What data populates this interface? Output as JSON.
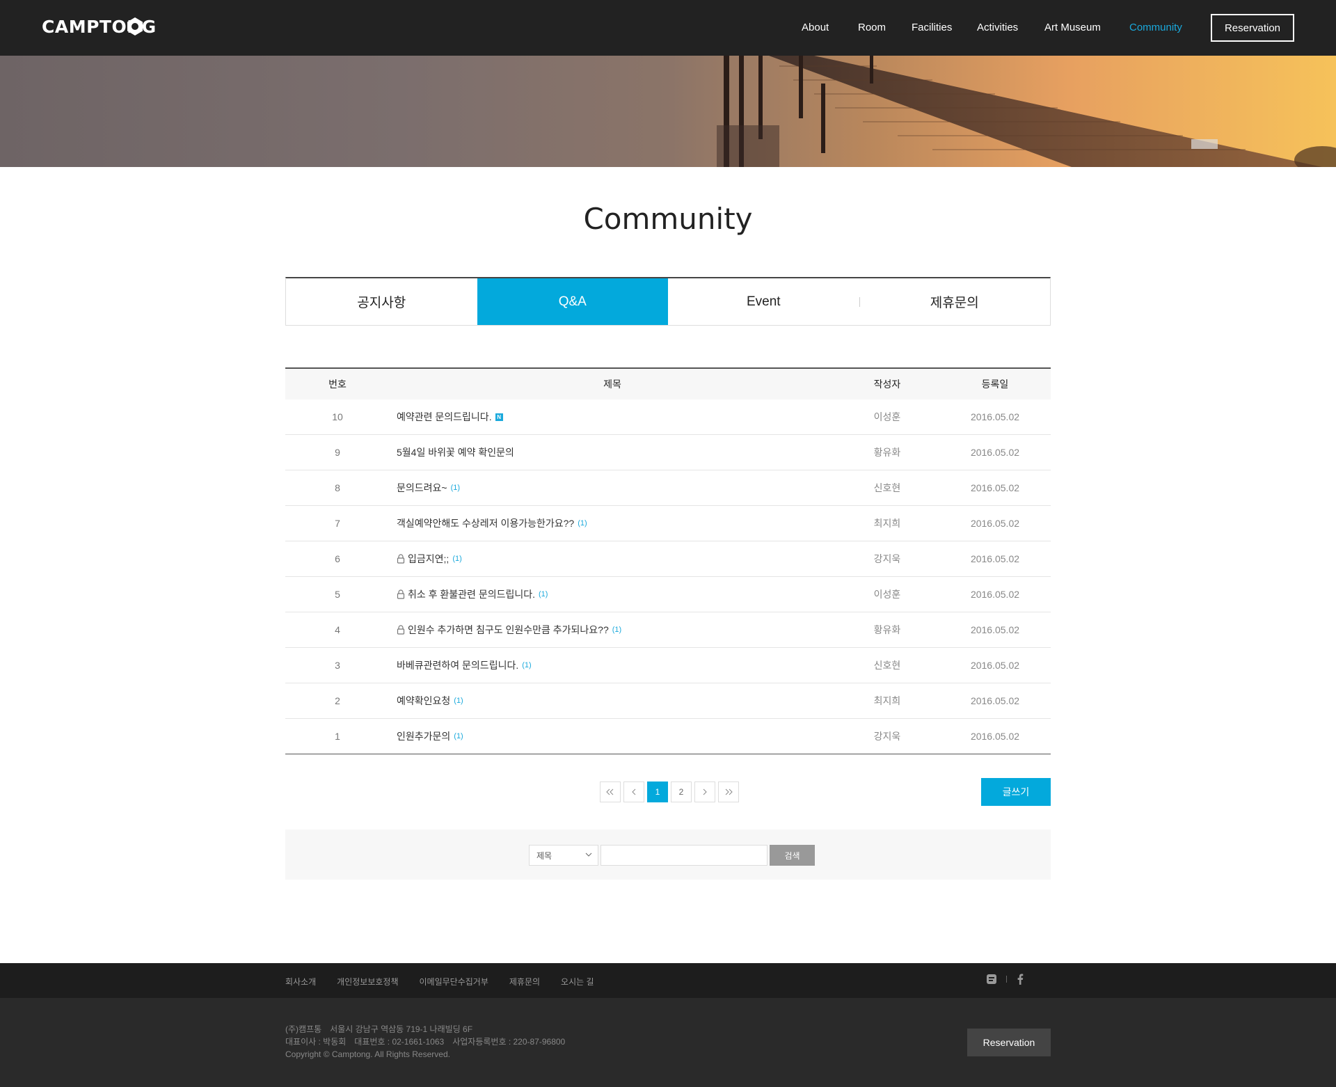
{
  "header": {
    "logo": "CAMPTONG",
    "nav": [
      "About",
      "Room",
      "Facilities",
      "Activities",
      "Art Museum",
      "Community"
    ],
    "active_nav": "Community",
    "reservation_label": "Reservation"
  },
  "colors": {
    "accent": "#03a9dc",
    "header_bg": "#222222",
    "footer_bg": "#1d1d1d"
  },
  "page_title": "Community",
  "tabs": [
    "공지사항",
    "Q&A",
    "Event",
    "제휴문의"
  ],
  "active_tab": "Q&A",
  "table": {
    "headers": {
      "no": "번호",
      "title": "제목",
      "author": "작성자",
      "date": "등록일"
    },
    "rows": [
      {
        "no": "10",
        "title": "예약관련 문의드립니다.",
        "comments": "",
        "new": true,
        "locked": false,
        "author": "이성훈",
        "date": "2016.05.02"
      },
      {
        "no": "9",
        "title": "5월4일 바위꽃 예약 확인문의",
        "comments": "",
        "new": false,
        "locked": false,
        "author": "황유화",
        "date": "2016.05.02"
      },
      {
        "no": "8",
        "title": "문의드려요~",
        "comments": "(1)",
        "new": false,
        "locked": false,
        "author": "신호현",
        "date": "2016.05.02"
      },
      {
        "no": "7",
        "title": "객실예약안해도 수상레저 이용가능한가요??",
        "comments": "(1)",
        "new": false,
        "locked": false,
        "author": "최지희",
        "date": "2016.05.02"
      },
      {
        "no": "6",
        "title": "입금지연;;",
        "comments": "(1)",
        "new": false,
        "locked": true,
        "author": "강지욱",
        "date": "2016.05.02"
      },
      {
        "no": "5",
        "title": "취소 후 환불관련 문의드립니다.",
        "comments": "(1)",
        "new": false,
        "locked": true,
        "author": "이성훈",
        "date": "2016.05.02"
      },
      {
        "no": "4",
        "title": "인원수 추가하면 침구도 인원수만큼 추가되나요??",
        "comments": "(1)",
        "new": false,
        "locked": true,
        "author": "황유화",
        "date": "2016.05.02"
      },
      {
        "no": "3",
        "title": "바베큐관련하여 문의드립니다.",
        "comments": "(1)",
        "new": false,
        "locked": false,
        "author": "신호현",
        "date": "2016.05.02"
      },
      {
        "no": "2",
        "title": "예약확인요청",
        "comments": "(1)",
        "new": false,
        "locked": false,
        "author": "최지희",
        "date": "2016.05.02"
      },
      {
        "no": "1",
        "title": "인원추가문의",
        "comments": "(1)",
        "new": false,
        "locked": false,
        "author": "강지욱",
        "date": "2016.05.02"
      }
    ],
    "new_badge": "N"
  },
  "pagination": {
    "pages": [
      "1",
      "2"
    ],
    "current": "1"
  },
  "write_button": "글쓰기",
  "search": {
    "field_option": "제목",
    "input_value": "",
    "button": "검색"
  },
  "footer": {
    "links": [
      "회사소개",
      "개인정보보호정책",
      "이메일무단수집거부",
      "제휴문의",
      "오시는 길"
    ],
    "company": "(주)캠프통",
    "address": "서울시 강남구 역삼동 719-1 나래빌딩 6F",
    "ceo": "대표이사 : 박동회",
    "phone": "대표번호 : 02-1661-1063",
    "biz_no": "사업자등록번호 : 220-87-96800",
    "copyright": "Copyright © Camptong. All Rights Reserved.",
    "reservation_label": "Reservation",
    "social": [
      "blog-icon",
      "facebook-icon"
    ]
  }
}
